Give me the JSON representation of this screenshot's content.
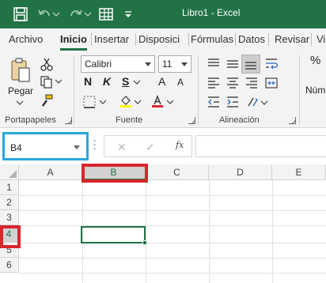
{
  "titlebar": {
    "title": "Libro1  -  Excel"
  },
  "tabs": [
    "Archivo",
    "Inicio",
    "Insertar",
    "Disposici",
    "Fórmulas",
    "Datos",
    "Revisar",
    "Vi"
  ],
  "ribbon": {
    "clipboard": {
      "paste_label": "Pegar",
      "group_label": "Portapapeles"
    },
    "font": {
      "font_name": "Calibri",
      "font_size": "11",
      "bold": "N",
      "italic": "K",
      "underline": "S",
      "grow": "A",
      "shrink": "A",
      "group_label": "Fuente"
    },
    "alignment": {
      "group_label": "Alineación"
    },
    "number": {
      "percent": "%",
      "label": "Núm"
    }
  },
  "formula_bar": {
    "name_box": "B4",
    "fx": "fx",
    "cancel": "✕",
    "enter": "✓"
  },
  "grid": {
    "columns": [
      "A",
      "B",
      "C",
      "D",
      "E"
    ],
    "rows": [
      "1",
      "2",
      "3",
      "4",
      "5",
      "6"
    ],
    "selected_column": "B",
    "selected_row": "4"
  },
  "colors": {
    "accent": "#217346",
    "highlight_blue": "#29a8e0",
    "highlight_red": "#d9262c"
  }
}
